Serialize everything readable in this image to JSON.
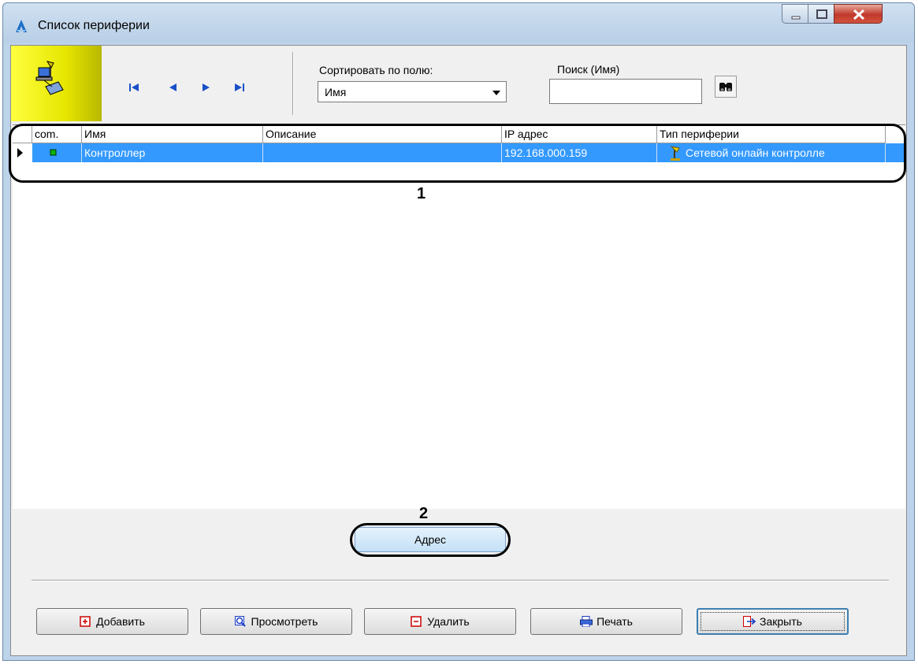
{
  "window": {
    "title": "Список периферии",
    "app_icon": "app-logo-icon",
    "controls": [
      "minimize-icon",
      "maximize-icon",
      "close-icon"
    ]
  },
  "toolbar": {
    "logo_icon": "peripheral-network-icon",
    "nav": [
      "first-record-icon",
      "prev-record-icon",
      "next-record-icon",
      "last-record-icon"
    ],
    "sort_label": "Сортировать по полю:",
    "sort_value": "Имя",
    "search_label": "Поиск (Имя)",
    "search_value": "",
    "search_icon": "binoculars-icon"
  },
  "grid": {
    "columns": [
      "com.",
      "Имя",
      "Описание",
      "IP адрес",
      "Тип периферии"
    ],
    "rows": [
      {
        "com": "status-led-icon",
        "name": "Контроллер",
        "description": "",
        "ip": "192.168.000.159",
        "type": "Сетевой онлайн контролле",
        "type_icon": "controller-icon",
        "selected": true
      }
    ]
  },
  "callouts": {
    "one": "1",
    "two": "2"
  },
  "address_button": "Адрес",
  "buttons": {
    "add": "Добавить",
    "view": "Просмотреть",
    "delete": "Удалить",
    "print": "Печать",
    "close": "Закрыть"
  },
  "colors": {
    "selection": "#3399ff",
    "logo_bg": "#e6e600",
    "accent_red": "#cc0000",
    "accent_blue": "#1a3cc8"
  }
}
